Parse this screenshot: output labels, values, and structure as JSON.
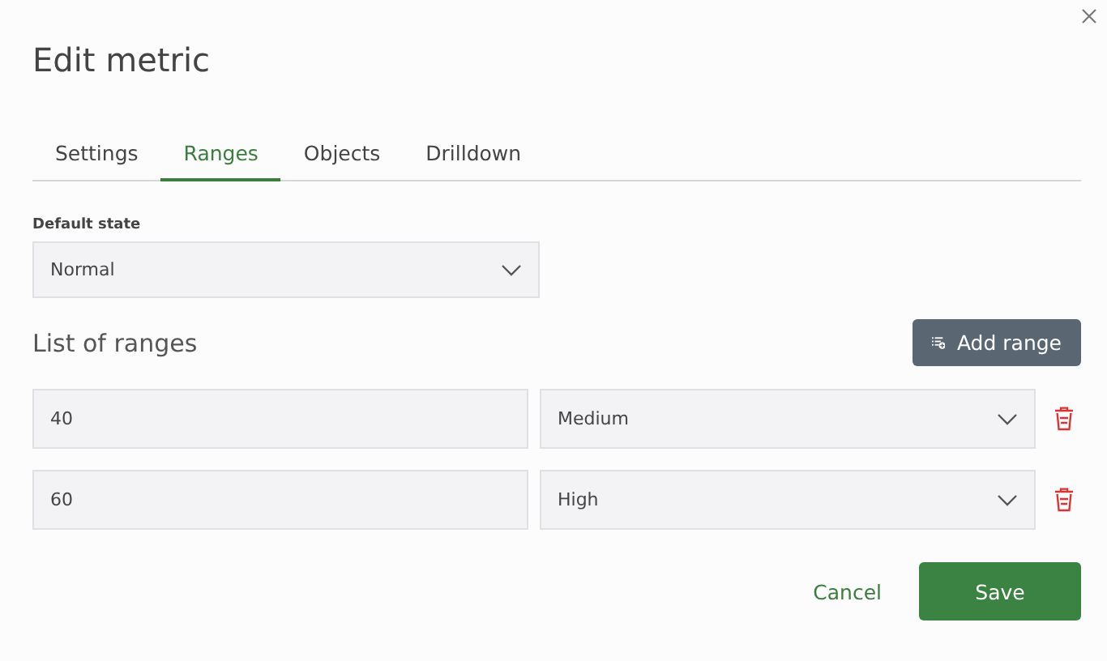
{
  "dialog": {
    "title": "Edit metric"
  },
  "tabs": [
    {
      "label": "Settings",
      "selected": false
    },
    {
      "label": "Ranges",
      "selected": true
    },
    {
      "label": "Objects",
      "selected": false
    },
    {
      "label": "Drilldown",
      "selected": false
    }
  ],
  "default_state": {
    "label": "Default state",
    "value": "Normal"
  },
  "ranges": {
    "heading": "List of ranges",
    "add_button": "Add range",
    "rows": [
      {
        "value": "40",
        "state": "Medium"
      },
      {
        "value": "60",
        "state": "High"
      }
    ]
  },
  "buttons": {
    "cancel": "Cancel",
    "save": "Save"
  }
}
